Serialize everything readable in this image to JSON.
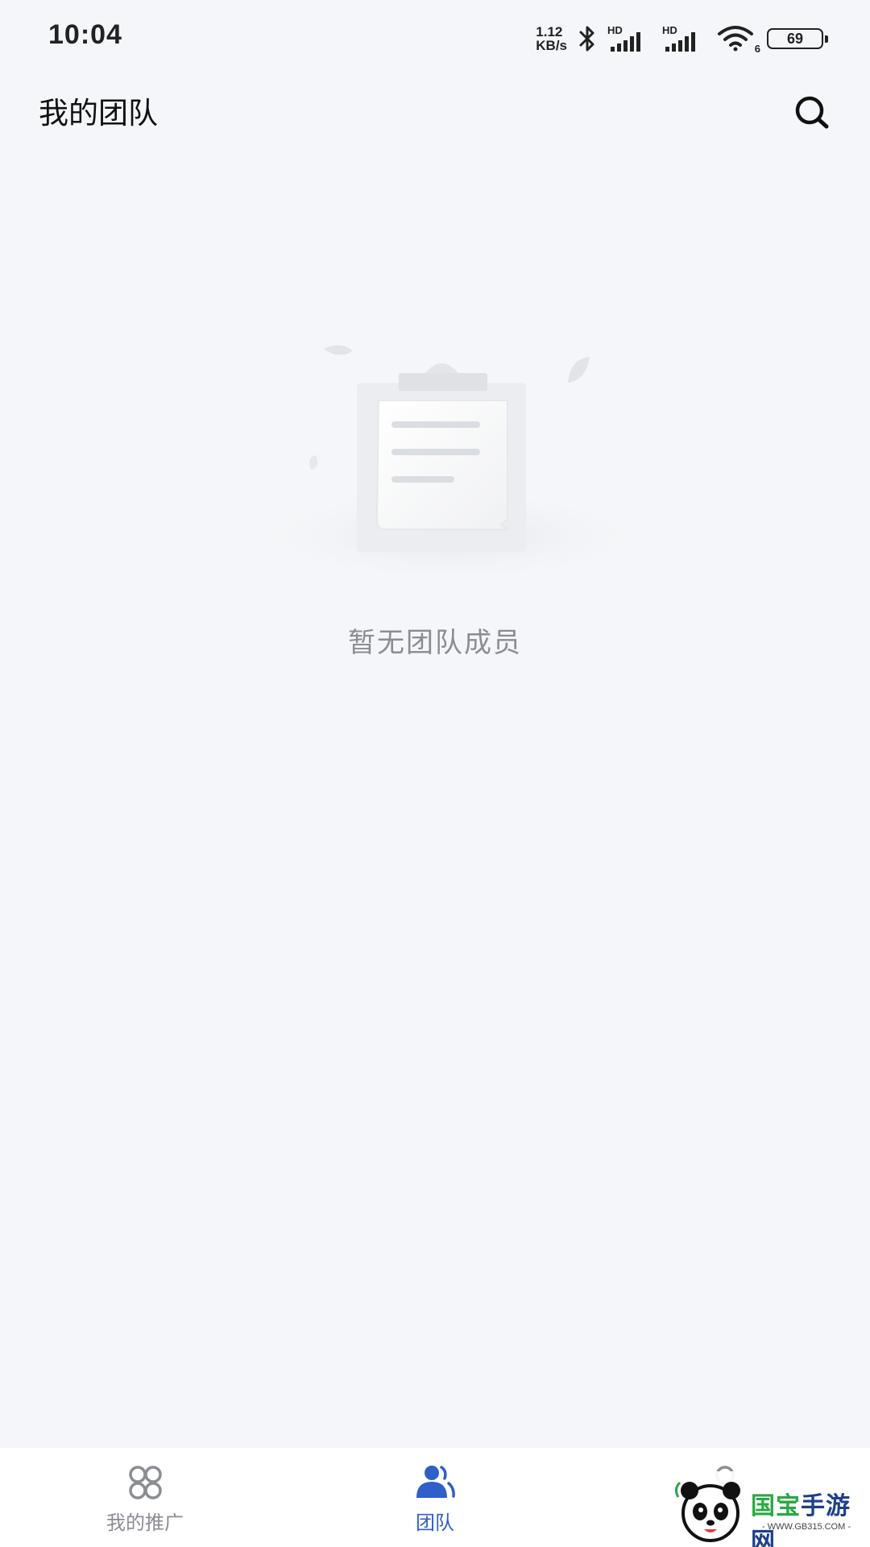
{
  "status_bar": {
    "time": "10:04",
    "net_speed_value": "1.12",
    "net_speed_unit": "KB/s",
    "signal_1_label": "HD",
    "signal_2_label": "HD",
    "wifi_label": "6",
    "battery": "69",
    "icons": [
      "bluetooth-icon",
      "signal-icon",
      "signal-icon",
      "wifi-icon",
      "battery-icon"
    ]
  },
  "header": {
    "title": "我的团队",
    "search_icon": "search-icon"
  },
  "empty_state": {
    "illustration": "clipboard-document",
    "message": "暂无团队成员"
  },
  "bottom_nav": {
    "active_color": "#2f5fc8",
    "inactive_color": "#8a8d93",
    "items": [
      {
        "label": "我的推广",
        "icon": "grid-icon",
        "active": false
      },
      {
        "label": "团队",
        "icon": "team-icon",
        "active": true
      },
      {
        "label": "",
        "icon": "profile-icon",
        "active": false
      }
    ]
  },
  "watermark": {
    "name_part_1": "国宝",
    "name_part_2": "手游网",
    "url": "- WWW.GB315.COM -"
  }
}
